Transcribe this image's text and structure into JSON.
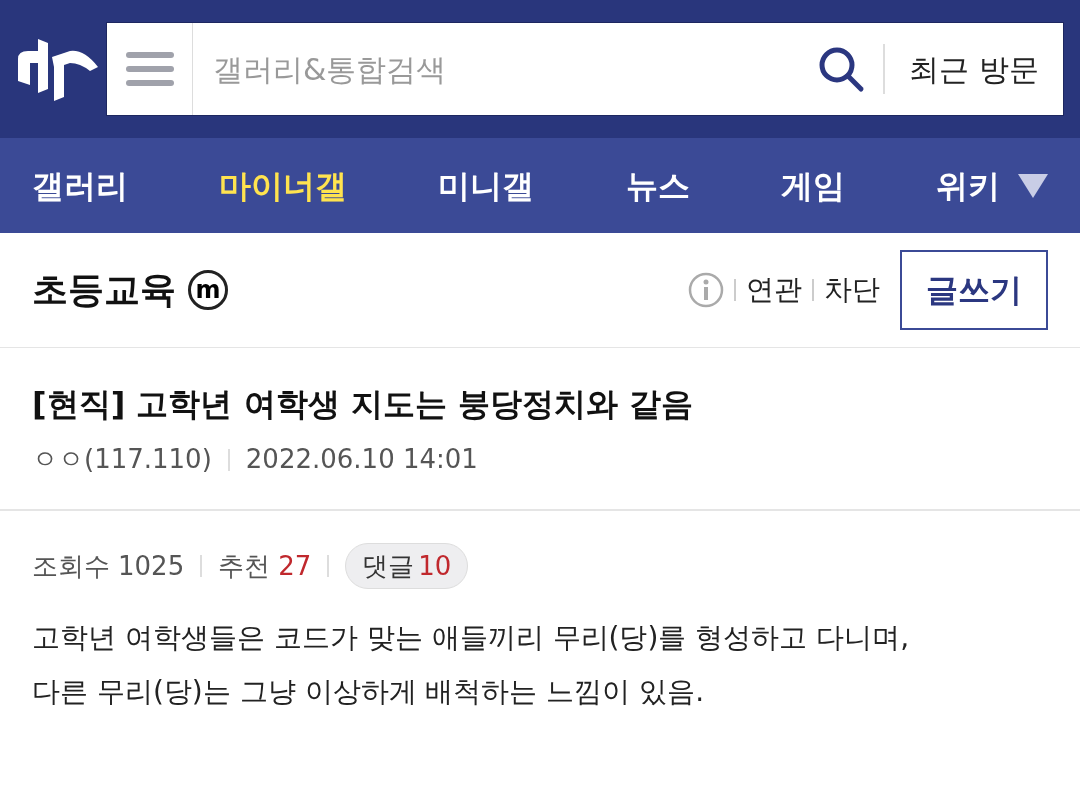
{
  "search": {
    "placeholder": "갤러리&통합검색",
    "recent_label": "최근 방문"
  },
  "nav": [
    {
      "label": "갤러리",
      "selected": false
    },
    {
      "label": "마이너갤",
      "selected": true
    },
    {
      "label": "미니갤",
      "selected": false
    },
    {
      "label": "뉴스",
      "selected": false
    },
    {
      "label": "게임",
      "selected": false
    },
    {
      "label": "위키",
      "selected": false
    }
  ],
  "gallery": {
    "name": "초등교육",
    "badge": "m",
    "links": [
      "연관",
      "차단"
    ],
    "write_button": "글쓰기"
  },
  "post": {
    "title": "[현직] 고학년 여학생 지도는 붕당정치와 같음",
    "author": "ㅇㅇ(117.110)",
    "date": "2022.06.10 14:01",
    "stats": [
      {
        "kind": "plain",
        "label": "조회수",
        "value": "1025"
      },
      {
        "kind": "highlight",
        "label": "추천",
        "value": "27"
      },
      {
        "kind": "pill",
        "label": "댓글",
        "value": "10"
      }
    ],
    "body": [
      "고학년 여학생들은 코드가 맞는 애들끼리 무리(당)를 형성하고 다니며,",
      "다른 무리(당)는 그냥 이상하게 배척하는 느낌이 있음."
    ]
  }
}
